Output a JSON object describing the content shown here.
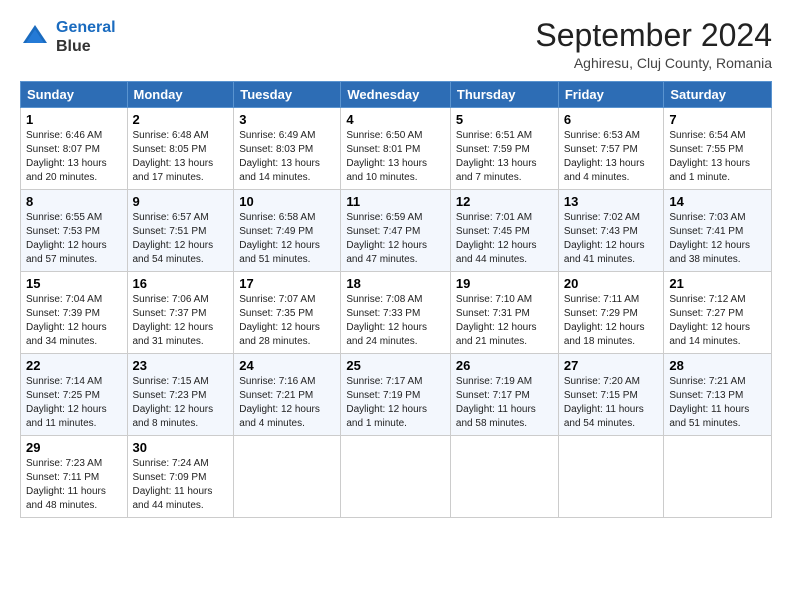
{
  "logo": {
    "line1": "General",
    "line2": "Blue"
  },
  "title": "September 2024",
  "location": "Aghiresu, Cluj County, Romania",
  "weekdays": [
    "Sunday",
    "Monday",
    "Tuesday",
    "Wednesday",
    "Thursday",
    "Friday",
    "Saturday"
  ],
  "weeks": [
    [
      {
        "day": "1",
        "sunrise": "6:46 AM",
        "sunset": "8:07 PM",
        "daylight": "13 hours and 20 minutes."
      },
      {
        "day": "2",
        "sunrise": "6:48 AM",
        "sunset": "8:05 PM",
        "daylight": "13 hours and 17 minutes."
      },
      {
        "day": "3",
        "sunrise": "6:49 AM",
        "sunset": "8:03 PM",
        "daylight": "13 hours and 14 minutes."
      },
      {
        "day": "4",
        "sunrise": "6:50 AM",
        "sunset": "8:01 PM",
        "daylight": "13 hours and 10 minutes."
      },
      {
        "day": "5",
        "sunrise": "6:51 AM",
        "sunset": "7:59 PM",
        "daylight": "13 hours and 7 minutes."
      },
      {
        "day": "6",
        "sunrise": "6:53 AM",
        "sunset": "7:57 PM",
        "daylight": "13 hours and 4 minutes."
      },
      {
        "day": "7",
        "sunrise": "6:54 AM",
        "sunset": "7:55 PM",
        "daylight": "13 hours and 1 minute."
      }
    ],
    [
      {
        "day": "8",
        "sunrise": "6:55 AM",
        "sunset": "7:53 PM",
        "daylight": "12 hours and 57 minutes."
      },
      {
        "day": "9",
        "sunrise": "6:57 AM",
        "sunset": "7:51 PM",
        "daylight": "12 hours and 54 minutes."
      },
      {
        "day": "10",
        "sunrise": "6:58 AM",
        "sunset": "7:49 PM",
        "daylight": "12 hours and 51 minutes."
      },
      {
        "day": "11",
        "sunrise": "6:59 AM",
        "sunset": "7:47 PM",
        "daylight": "12 hours and 47 minutes."
      },
      {
        "day": "12",
        "sunrise": "7:01 AM",
        "sunset": "7:45 PM",
        "daylight": "12 hours and 44 minutes."
      },
      {
        "day": "13",
        "sunrise": "7:02 AM",
        "sunset": "7:43 PM",
        "daylight": "12 hours and 41 minutes."
      },
      {
        "day": "14",
        "sunrise": "7:03 AM",
        "sunset": "7:41 PM",
        "daylight": "12 hours and 38 minutes."
      }
    ],
    [
      {
        "day": "15",
        "sunrise": "7:04 AM",
        "sunset": "7:39 PM",
        "daylight": "12 hours and 34 minutes."
      },
      {
        "day": "16",
        "sunrise": "7:06 AM",
        "sunset": "7:37 PM",
        "daylight": "12 hours and 31 minutes."
      },
      {
        "day": "17",
        "sunrise": "7:07 AM",
        "sunset": "7:35 PM",
        "daylight": "12 hours and 28 minutes."
      },
      {
        "day": "18",
        "sunrise": "7:08 AM",
        "sunset": "7:33 PM",
        "daylight": "12 hours and 24 minutes."
      },
      {
        "day": "19",
        "sunrise": "7:10 AM",
        "sunset": "7:31 PM",
        "daylight": "12 hours and 21 minutes."
      },
      {
        "day": "20",
        "sunrise": "7:11 AM",
        "sunset": "7:29 PM",
        "daylight": "12 hours and 18 minutes."
      },
      {
        "day": "21",
        "sunrise": "7:12 AM",
        "sunset": "7:27 PM",
        "daylight": "12 hours and 14 minutes."
      }
    ],
    [
      {
        "day": "22",
        "sunrise": "7:14 AM",
        "sunset": "7:25 PM",
        "daylight": "12 hours and 11 minutes."
      },
      {
        "day": "23",
        "sunrise": "7:15 AM",
        "sunset": "7:23 PM",
        "daylight": "12 hours and 8 minutes."
      },
      {
        "day": "24",
        "sunrise": "7:16 AM",
        "sunset": "7:21 PM",
        "daylight": "12 hours and 4 minutes."
      },
      {
        "day": "25",
        "sunrise": "7:17 AM",
        "sunset": "7:19 PM",
        "daylight": "12 hours and 1 minute."
      },
      {
        "day": "26",
        "sunrise": "7:19 AM",
        "sunset": "7:17 PM",
        "daylight": "11 hours and 58 minutes."
      },
      {
        "day": "27",
        "sunrise": "7:20 AM",
        "sunset": "7:15 PM",
        "daylight": "11 hours and 54 minutes."
      },
      {
        "day": "28",
        "sunrise": "7:21 AM",
        "sunset": "7:13 PM",
        "daylight": "11 hours and 51 minutes."
      }
    ],
    [
      {
        "day": "29",
        "sunrise": "7:23 AM",
        "sunset": "7:11 PM",
        "daylight": "11 hours and 48 minutes."
      },
      {
        "day": "30",
        "sunrise": "7:24 AM",
        "sunset": "7:09 PM",
        "daylight": "11 hours and 44 minutes."
      },
      null,
      null,
      null,
      null,
      null
    ]
  ]
}
